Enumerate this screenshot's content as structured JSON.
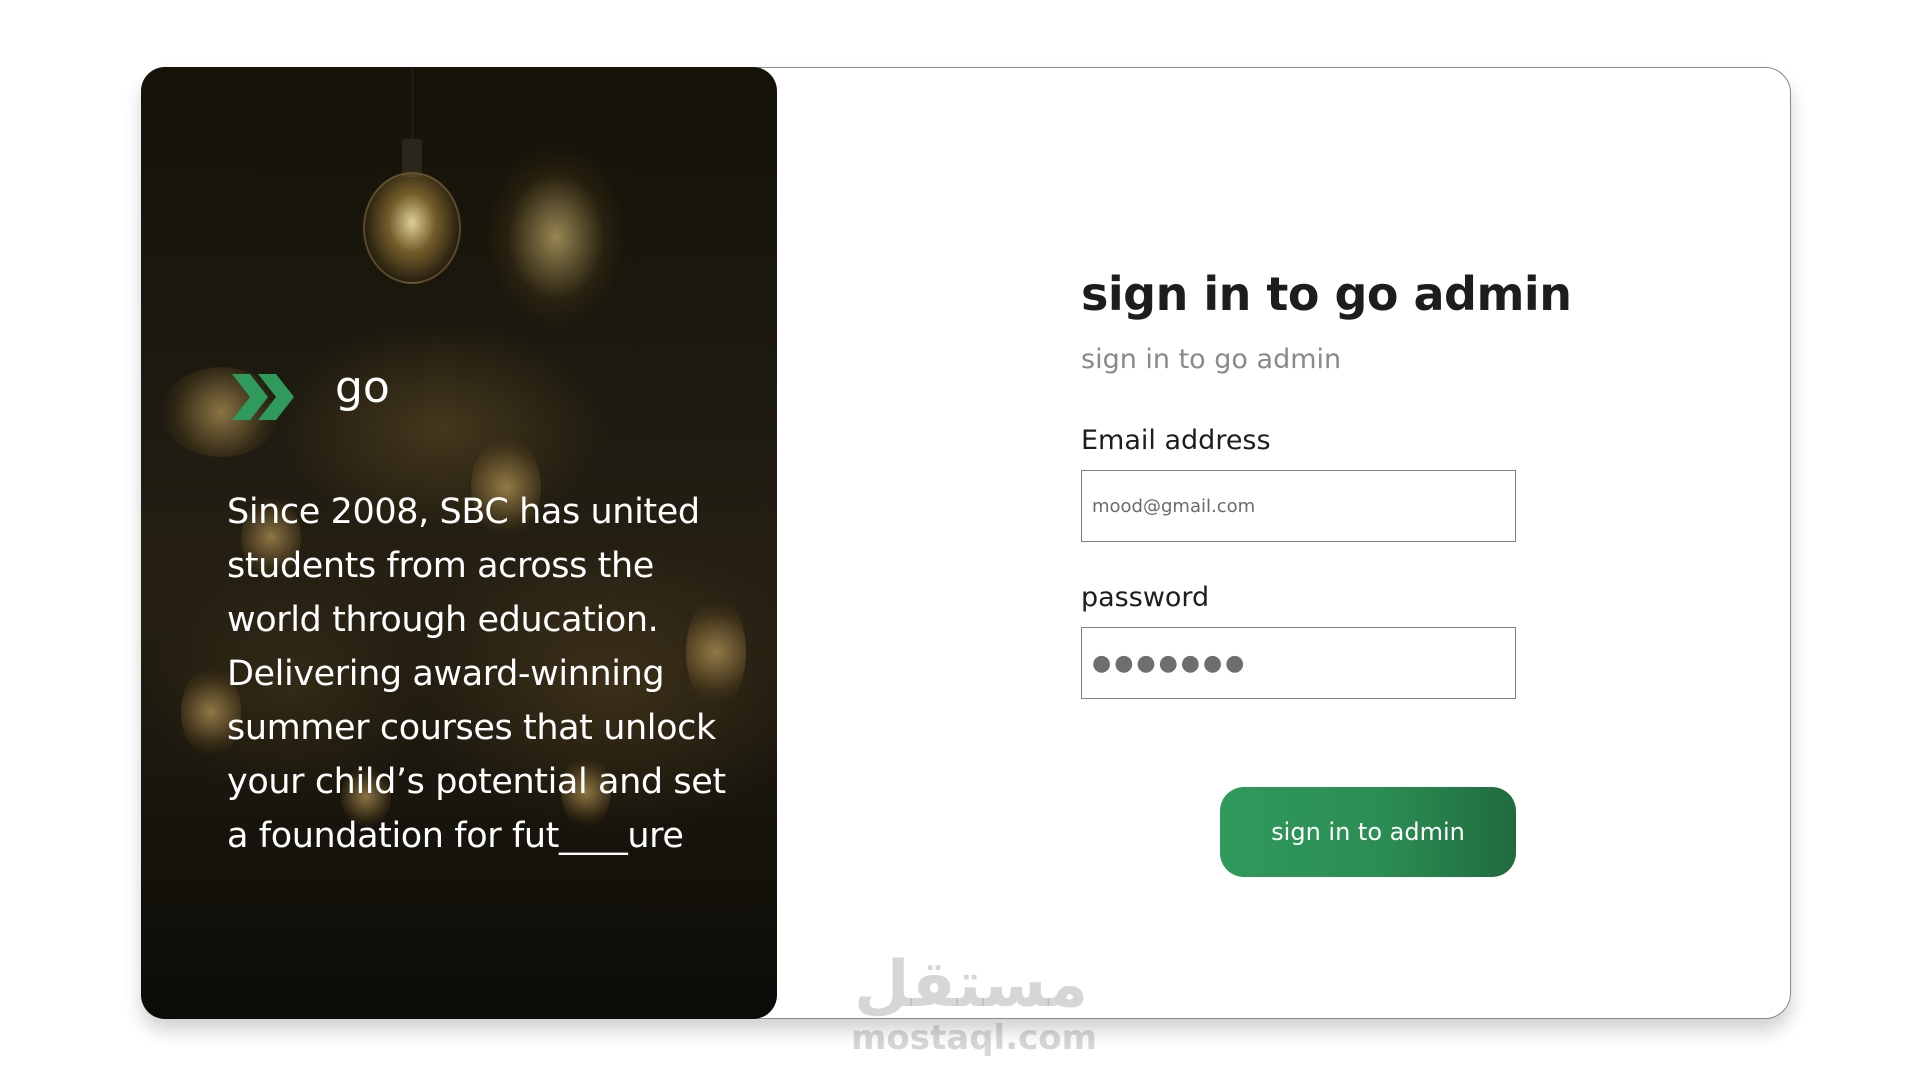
{
  "brand": {
    "name": "go",
    "logo_icon": "double-chevron-right-icon",
    "logo_color": "#2f9a5b"
  },
  "hero": {
    "description": "Since 2008, SBC has united students from across the world through education. Delivering award-winning summer courses that unlock your child’s potential and set a foundation for fut____ure"
  },
  "form": {
    "title": "sign in to go admin",
    "subtitle": "sign in to go admin",
    "email_label": "Email address",
    "email_placeholder": "mood@gmail.com",
    "password_label": "password",
    "password_value": "●●●●●●●",
    "submit_label": "sign in to admin"
  },
  "watermark": {
    "arabic": "مستقل",
    "latin": "mostaql.com"
  },
  "colors": {
    "accent": "#2f9a5b",
    "title_text": "#1d1d1d",
    "subtitle_text": "#8a8a8a"
  }
}
